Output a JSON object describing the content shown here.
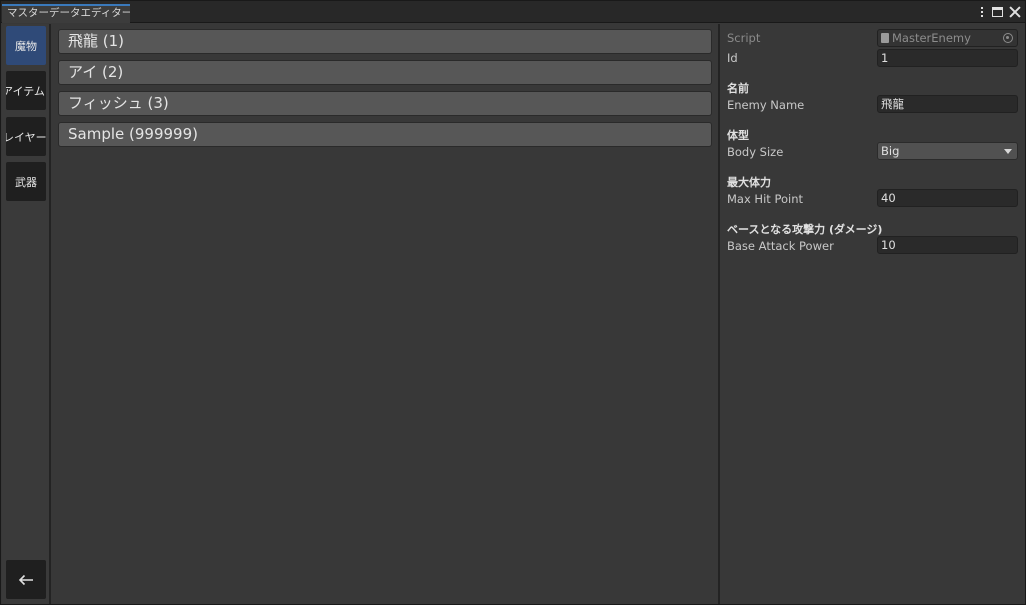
{
  "window": {
    "tab_title": "マスターデータエディター"
  },
  "sidebar": {
    "items": [
      {
        "label": "魔物"
      },
      {
        "label": "アイテム"
      },
      {
        "label": "プレイヤー"
      },
      {
        "label": "武器"
      }
    ],
    "back_icon": "arrow-left-icon"
  },
  "list": {
    "items": [
      {
        "label": "飛龍 (1)"
      },
      {
        "label": "アイ (2)"
      },
      {
        "label": "フィッシュ (3)"
      },
      {
        "label": "Sample (999999)"
      }
    ]
  },
  "inspector": {
    "script_label": "Script",
    "script_value": "MasterEnemy",
    "id_label": "Id",
    "id_value": "1",
    "name_header": "名前",
    "name_label": "Enemy Name",
    "name_value": "飛龍",
    "size_header": "体型",
    "size_label": "Body Size",
    "size_value": "Big",
    "hp_header": "最大体力",
    "hp_label": "Max Hit Point",
    "hp_value": "40",
    "attack_header": "ベースとなる攻撃力 (ダメージ)",
    "attack_label": "Base Attack Power",
    "attack_value": "10"
  },
  "colors": {
    "accent": "#3a79bb",
    "active_tab": "#2f4a78",
    "panel": "#383838"
  }
}
